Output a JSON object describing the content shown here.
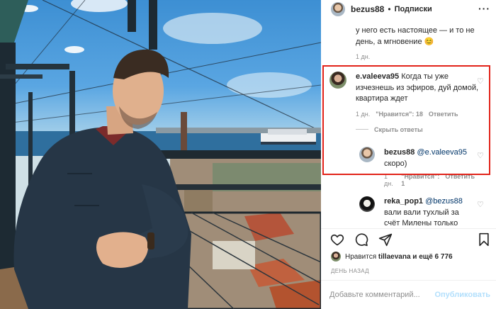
{
  "post": {
    "username": "bezus88",
    "separator": "•",
    "follow_label": "Подписки",
    "more_label": "···"
  },
  "comments": [
    {
      "text_tail": "у него есть настоящее — и то не день, а мгновение",
      "emoji": "😊",
      "time": "1 дн."
    },
    {
      "username": "e.valeeva95",
      "text": "Когда ты уже изчезнешь из эфиров, дуй домой, квартира ждет",
      "time": "1 дн.",
      "likes": "\"Нравится\": 18",
      "reply_label": "Ответить",
      "hide_replies_label": "Скрыть ответы"
    },
    {
      "username": "bezus88",
      "mention": "@e.valeeva95",
      "text": "скоро)",
      "time": "1 дн.",
      "likes": "\"Нравится\": 1",
      "reply_label": "Ответить"
    },
    {
      "username": "reka_pop1",
      "mention": "@bezus88",
      "text": "вали вали тухлый за счёт Милены только"
    }
  ],
  "likes_bar": {
    "prefix": "Нравится",
    "user": "tillaevana",
    "and_more": "и ещё 6 776",
    "time_ago": "ДЕНЬ НАЗАД"
  },
  "add_comment": {
    "placeholder": "Добавьте комментарий...",
    "publish_label": "Опубликовать"
  },
  "colors": {
    "highlight": "#e2231a",
    "link": "#003569",
    "muted": "#8e8e8e",
    "publish_disabled": "#b2dffc"
  },
  "icons": [
    "heart-icon",
    "comment-icon",
    "share-icon",
    "bookmark-icon",
    "more-icon"
  ]
}
